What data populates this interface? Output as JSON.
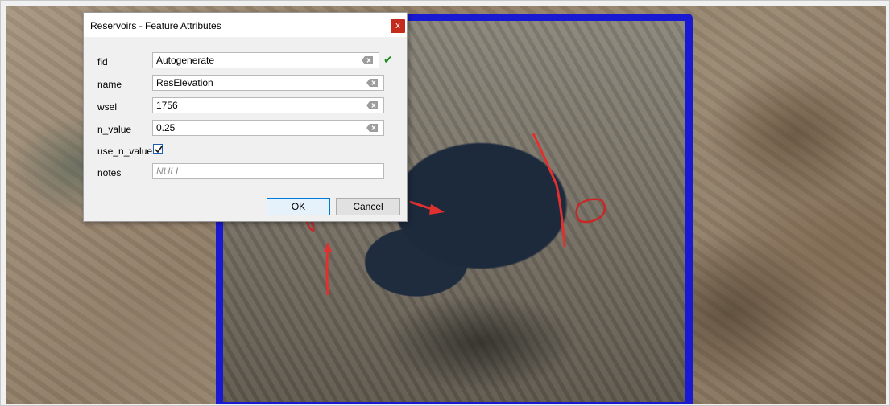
{
  "dialog": {
    "title": "Reservoirs - Feature Attributes",
    "close_label": "x",
    "fields": [
      {
        "label": "fid",
        "value": "Autogenerate"
      },
      {
        "label": "name",
        "value": "ResElevation"
      },
      {
        "label": "wsel",
        "value": "1756"
      },
      {
        "label": "n_value",
        "value": "0.25"
      },
      {
        "label": "use_n_value",
        "checked": true
      },
      {
        "label": "notes",
        "placeholder": "NULL"
      }
    ],
    "ok_label": "OK",
    "cancel_label": "Cancel"
  },
  "map": {
    "aoi_color": "#1919d2",
    "annotation_color": "#e03030"
  }
}
